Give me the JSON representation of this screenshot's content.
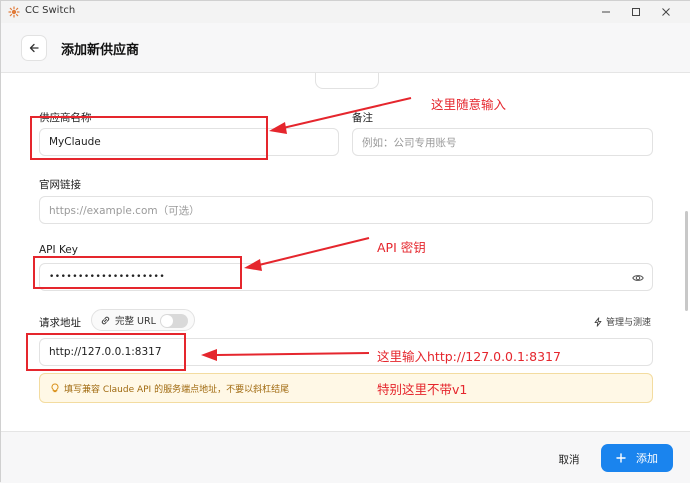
{
  "window": {
    "title": "CC Switch"
  },
  "header": {
    "title": "添加新供应商"
  },
  "form": {
    "name": {
      "label": "供应商名称",
      "value": "MyClaude"
    },
    "note": {
      "label": "备注",
      "placeholder": "例如：公司专用账号"
    },
    "website": {
      "label": "官网链接",
      "placeholder": "https://example.com（可选）"
    },
    "api_key": {
      "label": "API Key",
      "value": "••••••••••••••••••••"
    },
    "endpoint": {
      "label": "请求地址",
      "full_url_label": "完整 URL",
      "full_url_enabled": false,
      "manage_label": "管理与测速",
      "value": "http://127.0.0.1:8317",
      "hint": "填写兼容 Claude API 的服务端点地址，不要以斜杠结尾"
    }
  },
  "footer": {
    "cancel_label": "取消",
    "add_label": "添加"
  },
  "annotations": {
    "name": "这里随意输入",
    "api_key": "API 密钥",
    "endpoint": "这里输入http://127.0.0.1:8317",
    "note": "特别这里不带v1"
  },
  "colors": {
    "accent": "#1a84ee",
    "annotation": "#e5262d",
    "hint_bg": "#fff8e6"
  }
}
